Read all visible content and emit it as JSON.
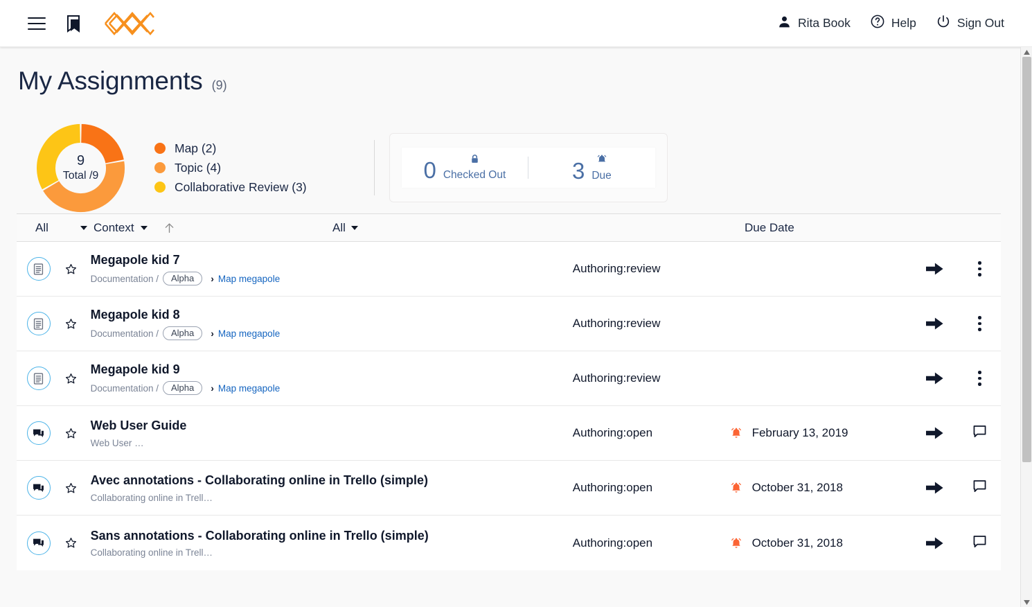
{
  "topbar": {
    "menu_icon": "hamburger-menu-icon",
    "bookmark_icon": "bookmark-icon",
    "logo_icon": "app-logo-icon",
    "user_name": "Rita Book",
    "help_label": "Help",
    "signout_label": "Sign Out"
  },
  "header": {
    "title": "My Assignments",
    "count": "(9)"
  },
  "chart_data": {
    "type": "pie",
    "title": "My Assignments",
    "center_value": "9",
    "center_label": "Total /9",
    "total": 9,
    "categories": [
      "Map",
      "Topic",
      "Collaborative Review"
    ],
    "values": [
      2,
      4,
      3
    ],
    "colors": [
      "#f97316",
      "#fb9a3c",
      "#fdc516"
    ],
    "legend": [
      {
        "label": "Map (2)",
        "color": "#f97316"
      },
      {
        "label": "Topic (4)",
        "color": "#fb9a3c"
      },
      {
        "label": "Collaborative Review (3)",
        "color": "#fdc516"
      }
    ],
    "legend_position": "right",
    "grid": false
  },
  "stats": {
    "checked_out": {
      "value": "0",
      "label": "Checked Out",
      "icon": "lock-icon"
    },
    "due": {
      "value": "3",
      "label": "Due",
      "icon": "bell-icon"
    },
    "accent_color": "#4a6fa5"
  },
  "table": {
    "filter_all_left": "All",
    "filter_context": "Context",
    "sort_icon": "sort-ascending-arrow-icon",
    "filter_all_right": "All",
    "due_date_header": "Due Date",
    "rows": [
      {
        "type_icon": "document-icon",
        "title": "Megapole kid 7",
        "breadcrumb_prefix": "Documentation /",
        "tag": "Alpha",
        "link": "Map megapole",
        "status": "Authoring:review",
        "due_date": "",
        "has_due_bell": false,
        "action_icon": "arrow-right-icon",
        "menu_icon": "kebab-menu-icon"
      },
      {
        "type_icon": "document-icon",
        "title": "Megapole kid 8",
        "breadcrumb_prefix": "Documentation /",
        "tag": "Alpha",
        "link": "Map megapole",
        "status": "Authoring:review",
        "due_date": "",
        "has_due_bell": false,
        "action_icon": "arrow-right-icon",
        "menu_icon": "kebab-menu-icon"
      },
      {
        "type_icon": "document-icon",
        "title": "Megapole kid 9",
        "breadcrumb_prefix": "Documentation /",
        "tag": "Alpha",
        "link": "Map megapole",
        "status": "Authoring:review",
        "due_date": "",
        "has_due_bell": false,
        "action_icon": "arrow-right-icon",
        "menu_icon": "kebab-menu-icon"
      },
      {
        "type_icon": "comment-icon",
        "title": "Web User Guide",
        "breadcrumb_prefix": "Web User …",
        "tag": "",
        "link": "",
        "status": "Authoring:open",
        "due_date": "February 13, 2019",
        "has_due_bell": true,
        "action_icon": "arrow-right-icon",
        "menu_icon": "comment-icon"
      },
      {
        "type_icon": "comment-icon",
        "title": "Avec annotations - Collaborating online in Trello (simple)",
        "breadcrumb_prefix": "Collaborating online in Trell…",
        "tag": "",
        "link": "",
        "status": "Authoring:open",
        "due_date": "October 31, 2018",
        "has_due_bell": true,
        "action_icon": "arrow-right-icon",
        "menu_icon": "comment-icon"
      },
      {
        "type_icon": "comment-icon",
        "title": "Sans annotations - Collaborating online in Trello (simple)",
        "breadcrumb_prefix": "Collaborating online in Trell…",
        "tag": "",
        "link": "",
        "status": "Authoring:open",
        "due_date": "October 31, 2018",
        "has_due_bell": true,
        "action_icon": "arrow-right-icon",
        "menu_icon": "comment-icon"
      }
    ]
  }
}
